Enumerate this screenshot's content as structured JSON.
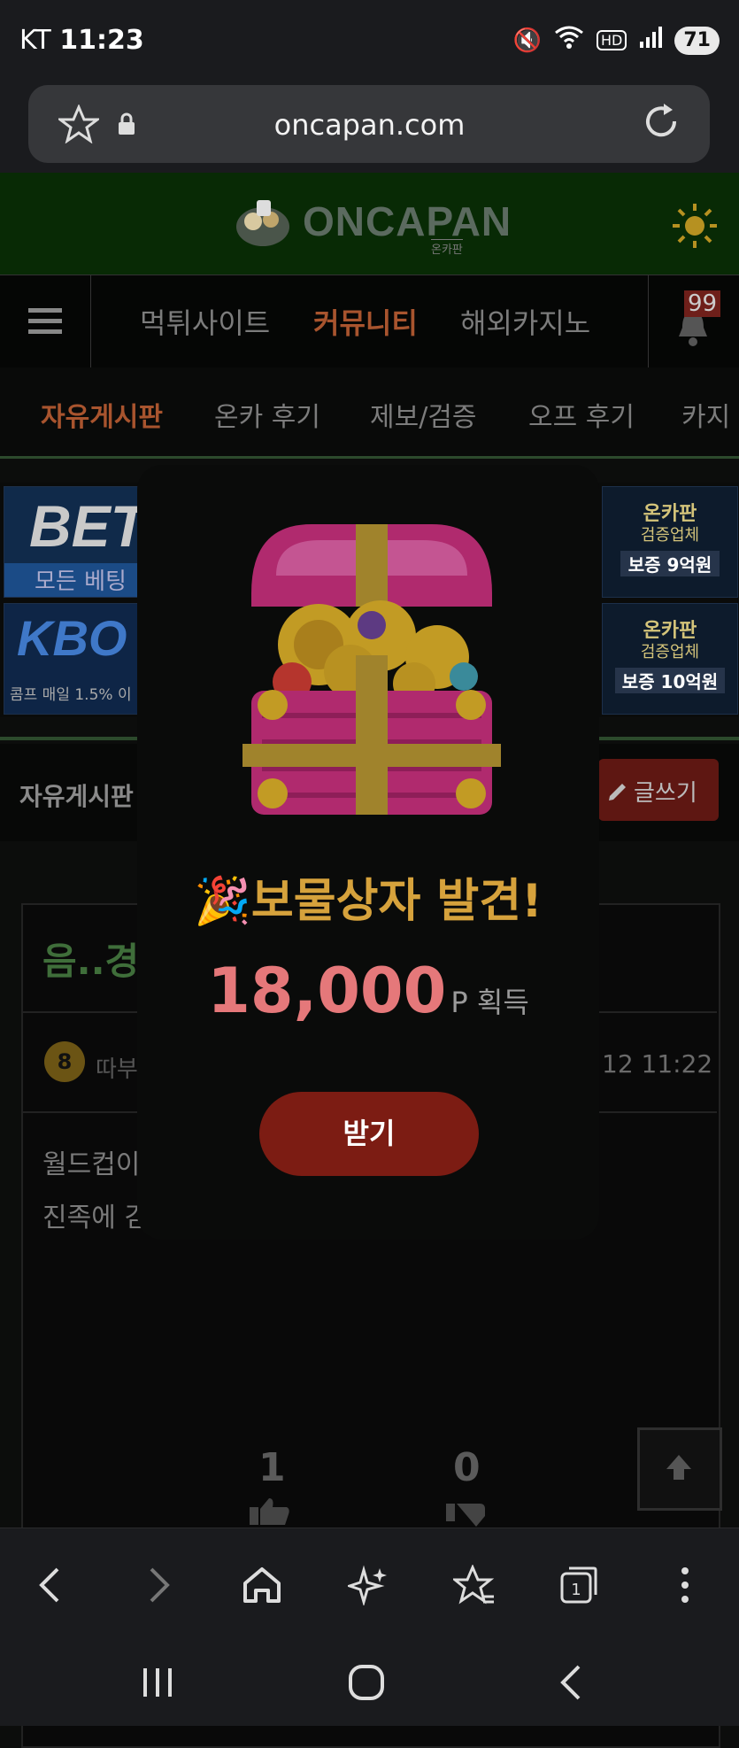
{
  "status_bar": {
    "carrier": "KT",
    "time": "11:23",
    "battery": "71"
  },
  "browser": {
    "url": "oncapan.com"
  },
  "site": {
    "logo_text": "ONCAPAN",
    "logo_sub": "온카판",
    "nav": [
      "먹튀사이트",
      "커뮤니티",
      "해외카지노"
    ],
    "notif_count": "99",
    "sub_nav": [
      "자유게시판",
      "온카 후기",
      "제보/검증",
      "오프 후기",
      "카지"
    ],
    "banners_left": [
      "BET",
      "모든 베팅",
      "KBO",
      "콤프 매일 1.5% 이"
    ],
    "banners_right": [
      "온카판",
      "검증업체",
      "보증 9억원",
      "온카판",
      "검증업체",
      "보증 10억원"
    ],
    "board_title": "자유게시판",
    "write_button": "글쓰기",
    "post_title": "음..경",
    "post_author": "따부",
    "author_level": "8",
    "post_date": "12 11:22",
    "post_body_1": "월드컵이",
    "post_body_2": "진족에 김",
    "likes": "1",
    "dislikes": "0"
  },
  "modal": {
    "title": "🎉보물상자 발견!",
    "points": "18,000",
    "points_unit": "P 획득",
    "claim_label": "받기"
  }
}
